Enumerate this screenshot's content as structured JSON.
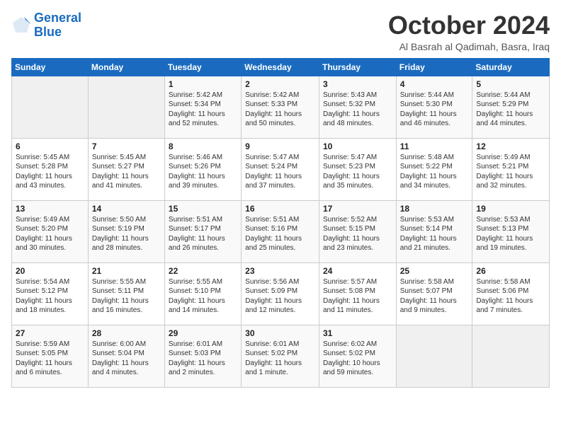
{
  "logo": {
    "line1": "General",
    "line2": "Blue"
  },
  "header": {
    "month": "October 2024",
    "location": "Al Basrah al Qadimah, Basra, Iraq"
  },
  "weekdays": [
    "Sunday",
    "Monday",
    "Tuesday",
    "Wednesday",
    "Thursday",
    "Friday",
    "Saturday"
  ],
  "weeks": [
    [
      {
        "day": "",
        "info": ""
      },
      {
        "day": "",
        "info": ""
      },
      {
        "day": "1",
        "info": "Sunrise: 5:42 AM\nSunset: 5:34 PM\nDaylight: 11 hours\nand 52 minutes."
      },
      {
        "day": "2",
        "info": "Sunrise: 5:42 AM\nSunset: 5:33 PM\nDaylight: 11 hours\nand 50 minutes."
      },
      {
        "day": "3",
        "info": "Sunrise: 5:43 AM\nSunset: 5:32 PM\nDaylight: 11 hours\nand 48 minutes."
      },
      {
        "day": "4",
        "info": "Sunrise: 5:44 AM\nSunset: 5:30 PM\nDaylight: 11 hours\nand 46 minutes."
      },
      {
        "day": "5",
        "info": "Sunrise: 5:44 AM\nSunset: 5:29 PM\nDaylight: 11 hours\nand 44 minutes."
      }
    ],
    [
      {
        "day": "6",
        "info": "Sunrise: 5:45 AM\nSunset: 5:28 PM\nDaylight: 11 hours\nand 43 minutes."
      },
      {
        "day": "7",
        "info": "Sunrise: 5:45 AM\nSunset: 5:27 PM\nDaylight: 11 hours\nand 41 minutes."
      },
      {
        "day": "8",
        "info": "Sunrise: 5:46 AM\nSunset: 5:26 PM\nDaylight: 11 hours\nand 39 minutes."
      },
      {
        "day": "9",
        "info": "Sunrise: 5:47 AM\nSunset: 5:24 PM\nDaylight: 11 hours\nand 37 minutes."
      },
      {
        "day": "10",
        "info": "Sunrise: 5:47 AM\nSunset: 5:23 PM\nDaylight: 11 hours\nand 35 minutes."
      },
      {
        "day": "11",
        "info": "Sunrise: 5:48 AM\nSunset: 5:22 PM\nDaylight: 11 hours\nand 34 minutes."
      },
      {
        "day": "12",
        "info": "Sunrise: 5:49 AM\nSunset: 5:21 PM\nDaylight: 11 hours\nand 32 minutes."
      }
    ],
    [
      {
        "day": "13",
        "info": "Sunrise: 5:49 AM\nSunset: 5:20 PM\nDaylight: 11 hours\nand 30 minutes."
      },
      {
        "day": "14",
        "info": "Sunrise: 5:50 AM\nSunset: 5:19 PM\nDaylight: 11 hours\nand 28 minutes."
      },
      {
        "day": "15",
        "info": "Sunrise: 5:51 AM\nSunset: 5:17 PM\nDaylight: 11 hours\nand 26 minutes."
      },
      {
        "day": "16",
        "info": "Sunrise: 5:51 AM\nSunset: 5:16 PM\nDaylight: 11 hours\nand 25 minutes."
      },
      {
        "day": "17",
        "info": "Sunrise: 5:52 AM\nSunset: 5:15 PM\nDaylight: 11 hours\nand 23 minutes."
      },
      {
        "day": "18",
        "info": "Sunrise: 5:53 AM\nSunset: 5:14 PM\nDaylight: 11 hours\nand 21 minutes."
      },
      {
        "day": "19",
        "info": "Sunrise: 5:53 AM\nSunset: 5:13 PM\nDaylight: 11 hours\nand 19 minutes."
      }
    ],
    [
      {
        "day": "20",
        "info": "Sunrise: 5:54 AM\nSunset: 5:12 PM\nDaylight: 11 hours\nand 18 minutes."
      },
      {
        "day": "21",
        "info": "Sunrise: 5:55 AM\nSunset: 5:11 PM\nDaylight: 11 hours\nand 16 minutes."
      },
      {
        "day": "22",
        "info": "Sunrise: 5:55 AM\nSunset: 5:10 PM\nDaylight: 11 hours\nand 14 minutes."
      },
      {
        "day": "23",
        "info": "Sunrise: 5:56 AM\nSunset: 5:09 PM\nDaylight: 11 hours\nand 12 minutes."
      },
      {
        "day": "24",
        "info": "Sunrise: 5:57 AM\nSunset: 5:08 PM\nDaylight: 11 hours\nand 11 minutes."
      },
      {
        "day": "25",
        "info": "Sunrise: 5:58 AM\nSunset: 5:07 PM\nDaylight: 11 hours\nand 9 minutes."
      },
      {
        "day": "26",
        "info": "Sunrise: 5:58 AM\nSunset: 5:06 PM\nDaylight: 11 hours\nand 7 minutes."
      }
    ],
    [
      {
        "day": "27",
        "info": "Sunrise: 5:59 AM\nSunset: 5:05 PM\nDaylight: 11 hours\nand 6 minutes."
      },
      {
        "day": "28",
        "info": "Sunrise: 6:00 AM\nSunset: 5:04 PM\nDaylight: 11 hours\nand 4 minutes."
      },
      {
        "day": "29",
        "info": "Sunrise: 6:01 AM\nSunset: 5:03 PM\nDaylight: 11 hours\nand 2 minutes."
      },
      {
        "day": "30",
        "info": "Sunrise: 6:01 AM\nSunset: 5:02 PM\nDaylight: 11 hours\nand 1 minute."
      },
      {
        "day": "31",
        "info": "Sunrise: 6:02 AM\nSunset: 5:02 PM\nDaylight: 10 hours\nand 59 minutes."
      },
      {
        "day": "",
        "info": ""
      },
      {
        "day": "",
        "info": ""
      }
    ]
  ]
}
